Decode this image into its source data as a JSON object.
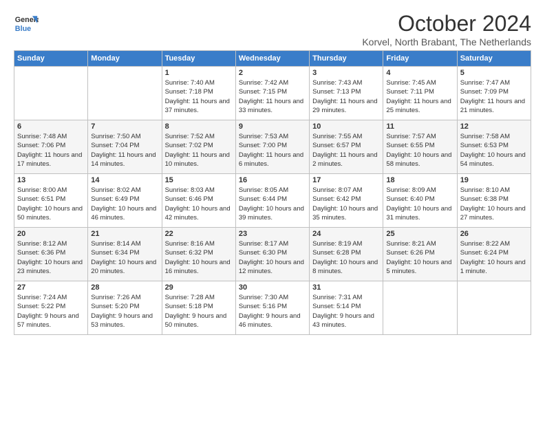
{
  "logo": {
    "line1": "General",
    "line2": "Blue"
  },
  "title": "October 2024",
  "location": "Korvel, North Brabant, The Netherlands",
  "days_of_week": [
    "Sunday",
    "Monday",
    "Tuesday",
    "Wednesday",
    "Thursday",
    "Friday",
    "Saturday"
  ],
  "weeks": [
    [
      {
        "day": "",
        "info": ""
      },
      {
        "day": "",
        "info": ""
      },
      {
        "day": "1",
        "sunrise": "7:40 AM",
        "sunset": "7:18 PM",
        "daylight": "11 hours and 37 minutes."
      },
      {
        "day": "2",
        "sunrise": "7:42 AM",
        "sunset": "7:15 PM",
        "daylight": "11 hours and 33 minutes."
      },
      {
        "day": "3",
        "sunrise": "7:43 AM",
        "sunset": "7:13 PM",
        "daylight": "11 hours and 29 minutes."
      },
      {
        "day": "4",
        "sunrise": "7:45 AM",
        "sunset": "7:11 PM",
        "daylight": "11 hours and 25 minutes."
      },
      {
        "day": "5",
        "sunrise": "7:47 AM",
        "sunset": "7:09 PM",
        "daylight": "11 hours and 21 minutes."
      }
    ],
    [
      {
        "day": "6",
        "sunrise": "7:48 AM",
        "sunset": "7:06 PM",
        "daylight": "11 hours and 17 minutes."
      },
      {
        "day": "7",
        "sunrise": "7:50 AM",
        "sunset": "7:04 PM",
        "daylight": "11 hours and 14 minutes."
      },
      {
        "day": "8",
        "sunrise": "7:52 AM",
        "sunset": "7:02 PM",
        "daylight": "11 hours and 10 minutes."
      },
      {
        "day": "9",
        "sunrise": "7:53 AM",
        "sunset": "7:00 PM",
        "daylight": "11 hours and 6 minutes."
      },
      {
        "day": "10",
        "sunrise": "7:55 AM",
        "sunset": "6:57 PM",
        "daylight": "11 hours and 2 minutes."
      },
      {
        "day": "11",
        "sunrise": "7:57 AM",
        "sunset": "6:55 PM",
        "daylight": "10 hours and 58 minutes."
      },
      {
        "day": "12",
        "sunrise": "7:58 AM",
        "sunset": "6:53 PM",
        "daylight": "10 hours and 54 minutes."
      }
    ],
    [
      {
        "day": "13",
        "sunrise": "8:00 AM",
        "sunset": "6:51 PM",
        "daylight": "10 hours and 50 minutes."
      },
      {
        "day": "14",
        "sunrise": "8:02 AM",
        "sunset": "6:49 PM",
        "daylight": "10 hours and 46 minutes."
      },
      {
        "day": "15",
        "sunrise": "8:03 AM",
        "sunset": "6:46 PM",
        "daylight": "10 hours and 42 minutes."
      },
      {
        "day": "16",
        "sunrise": "8:05 AM",
        "sunset": "6:44 PM",
        "daylight": "10 hours and 39 minutes."
      },
      {
        "day": "17",
        "sunrise": "8:07 AM",
        "sunset": "6:42 PM",
        "daylight": "10 hours and 35 minutes."
      },
      {
        "day": "18",
        "sunrise": "8:09 AM",
        "sunset": "6:40 PM",
        "daylight": "10 hours and 31 minutes."
      },
      {
        "day": "19",
        "sunrise": "8:10 AM",
        "sunset": "6:38 PM",
        "daylight": "10 hours and 27 minutes."
      }
    ],
    [
      {
        "day": "20",
        "sunrise": "8:12 AM",
        "sunset": "6:36 PM",
        "daylight": "10 hours and 23 minutes."
      },
      {
        "day": "21",
        "sunrise": "8:14 AM",
        "sunset": "6:34 PM",
        "daylight": "10 hours and 20 minutes."
      },
      {
        "day": "22",
        "sunrise": "8:16 AM",
        "sunset": "6:32 PM",
        "daylight": "10 hours and 16 minutes."
      },
      {
        "day": "23",
        "sunrise": "8:17 AM",
        "sunset": "6:30 PM",
        "daylight": "10 hours and 12 minutes."
      },
      {
        "day": "24",
        "sunrise": "8:19 AM",
        "sunset": "6:28 PM",
        "daylight": "10 hours and 8 minutes."
      },
      {
        "day": "25",
        "sunrise": "8:21 AM",
        "sunset": "6:26 PM",
        "daylight": "10 hours and 5 minutes."
      },
      {
        "day": "26",
        "sunrise": "8:22 AM",
        "sunset": "6:24 PM",
        "daylight": "10 hours and 1 minute."
      }
    ],
    [
      {
        "day": "27",
        "sunrise": "7:24 AM",
        "sunset": "5:22 PM",
        "daylight": "9 hours and 57 minutes."
      },
      {
        "day": "28",
        "sunrise": "7:26 AM",
        "sunset": "5:20 PM",
        "daylight": "9 hours and 53 minutes."
      },
      {
        "day": "29",
        "sunrise": "7:28 AM",
        "sunset": "5:18 PM",
        "daylight": "9 hours and 50 minutes."
      },
      {
        "day": "30",
        "sunrise": "7:30 AM",
        "sunset": "5:16 PM",
        "daylight": "9 hours and 46 minutes."
      },
      {
        "day": "31",
        "sunrise": "7:31 AM",
        "sunset": "5:14 PM",
        "daylight": "9 hours and 43 minutes."
      },
      {
        "day": "",
        "info": ""
      },
      {
        "day": "",
        "info": ""
      }
    ]
  ],
  "labels": {
    "sunrise": "Sunrise:",
    "sunset": "Sunset:",
    "daylight": "Daylight:"
  }
}
